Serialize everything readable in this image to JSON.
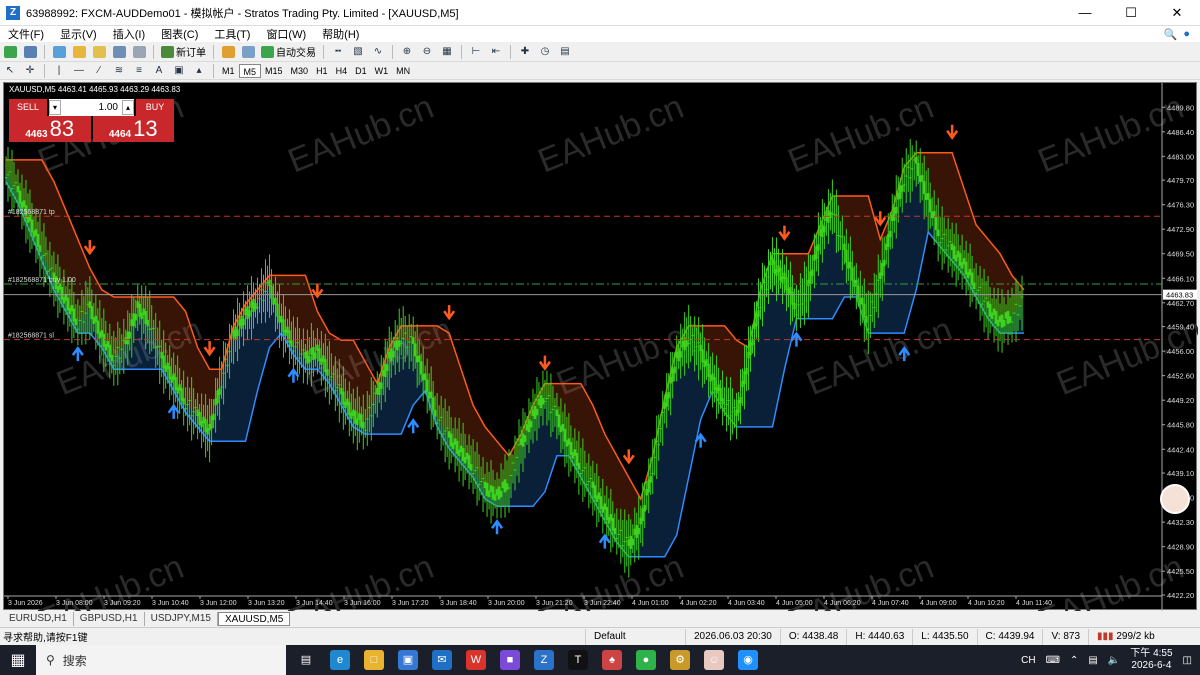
{
  "window": {
    "title": "63988992: FXCM-AUDDemo01 - 模拟帐户 - Stratos Trading Pty. Limited - [XAUUSD,M5]",
    "app_icon": "Z"
  },
  "menu": [
    "文件(F)",
    "显示(V)",
    "插入(I)",
    "图表(C)",
    "工具(T)",
    "窗口(W)",
    "帮助(H)"
  ],
  "toolbar": {
    "new_order": "新订单",
    "auto_trade": "自动交易",
    "timeframes": [
      "M1",
      "M5",
      "M15",
      "M30",
      "H1",
      "H4",
      "D1",
      "W1",
      "MN"
    ],
    "active_timeframe": "M5"
  },
  "chart": {
    "header": "XAUUSD,M5  4463.41 4465.93 4463.29 4463.83",
    "trade_panel": {
      "sell_label": "SELL",
      "buy_label": "BUY",
      "lot": "1.00",
      "sell_small": "4463",
      "sell_big": "83",
      "buy_small": "4464",
      "buy_big": "13"
    },
    "line_labels": {
      "tp": "#182568871 tp",
      "buy": "#182568871 buy 1.00",
      "sl": "#182568871 sl"
    },
    "current_price": "4463.83",
    "watermark": "EAHub.cn",
    "colors": {
      "up_candle": "#3cd21e",
      "resistance": "#ff5a1e",
      "support": "#2d8cff",
      "tp_sl_line": "#c0392b",
      "entry_line": "#3a9d3a"
    }
  },
  "chart_data": {
    "type": "candlestick",
    "symbol": "XAUUSD",
    "timeframe": "M5",
    "ylim": [
      4422.2,
      4491.5
    ],
    "y_ticks": [
      "4489.80",
      "4486.40",
      "4483.00",
      "4479.70",
      "4476.30",
      "4472.90",
      "4469.50",
      "4466.10",
      "4462.70",
      "4459.40",
      "4456.00",
      "4452.60",
      "4449.20",
      "4445.80",
      "4442.40",
      "4439.10",
      "4435.70",
      "4432.30",
      "4428.90",
      "4425.50",
      "4422.20"
    ],
    "x_ticks": [
      "3 Jun 2026",
      "3 Jun 08:00",
      "3 Jun 09:20",
      "3 Jun 10:40",
      "3 Jun 12:00",
      "3 Jun 13:20",
      "3 Jun 14:40",
      "3 Jun 16:00",
      "3 Jun 17:20",
      "3 Jun 18:40",
      "3 Jun 20:00",
      "3 Jun 21:20",
      "3 Jun 22:40",
      "4 Jun 01:00",
      "4 Jun 02:20",
      "4 Jun 03:40",
      "4 Jun 05:00",
      "4 Jun 06:20",
      "4 Jun 07:40",
      "4 Jun 09:00",
      "4 Jun 10:20",
      "4 Jun 11:40"
    ],
    "close_path": [
      4481,
      4478,
      4474,
      4470,
      4466,
      4463,
      4460,
      4462,
      4458,
      4455,
      4457,
      4462,
      4460,
      4455,
      4452,
      4449,
      4447,
      4445,
      4452,
      4458,
      4461,
      4463,
      4465,
      4460,
      4457,
      4455,
      4456,
      4453,
      4450,
      4447,
      4446,
      4450,
      4455,
      4458,
      4457,
      4452,
      4447,
      4444,
      4442,
      4440,
      4437,
      4436,
      4438,
      4443,
      4447,
      4450,
      4447,
      4443,
      4440,
      4437,
      4434,
      4431,
      4429,
      4432,
      4440,
      4448,
      4455,
      4458,
      4456,
      4452,
      4449,
      4447,
      4455,
      4463,
      4468,
      4466,
      4462,
      4465,
      4472,
      4476,
      4470,
      4465,
      4460,
      4466,
      4474,
      4480,
      4482,
      4477,
      4472,
      4470,
      4468,
      4465,
      4462,
      4460,
      4461,
      4463
    ],
    "tp_price": 4474.7,
    "entry_price": 4465.3,
    "sl_price": 4457.6,
    "current_price": 4463.83,
    "sell_arrows_x_index": [
      7,
      17,
      26,
      37,
      45,
      52,
      65,
      73,
      79
    ],
    "buy_arrows_x_index": [
      6,
      14,
      24,
      34,
      41,
      50,
      58,
      66,
      75
    ]
  },
  "tabs": [
    "EURUSD,H1",
    "GBPUSD,H1",
    "USDJPY,M15",
    "XAUUSD,M5"
  ],
  "active_tab": "XAUUSD,M5",
  "status": {
    "help": "寻求帮助,请按F1键",
    "profile": "Default",
    "datetime": "2026.06.03 20:30",
    "open": "O: 4438.48",
    "high": "H: 4440.63",
    "low": "L: 4435.50",
    "close": "C: 4439.94",
    "volume": "V: 873",
    "traffic": "299/2 kb"
  },
  "taskbar": {
    "search_placeholder": "搜索",
    "ime": "CH",
    "clock_time": "下午 4:55",
    "clock_date": "2026-6-4"
  }
}
